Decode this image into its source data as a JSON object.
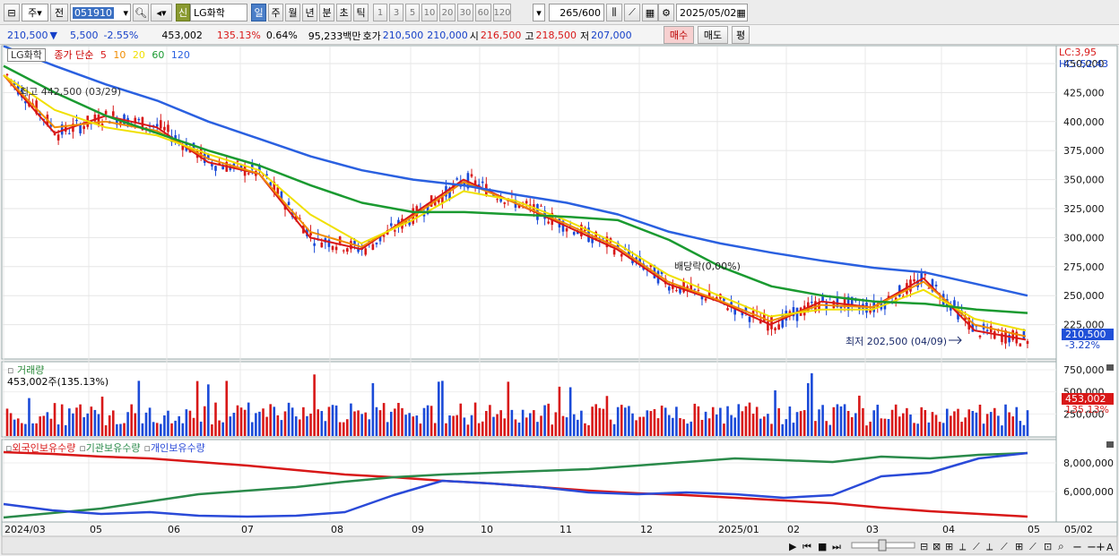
{
  "toolbar": {
    "period_label": "주",
    "prev_label": "전",
    "code": "051910",
    "name": "LG화학",
    "credit_badge": "신",
    "periods": [
      "일",
      "주",
      "월",
      "년",
      "분",
      "초",
      "틱"
    ],
    "counts": [
      "1",
      "3",
      "5",
      "10",
      "20",
      "30",
      "60",
      "120"
    ],
    "view_count": "265",
    "view_total": "/600",
    "date": "2025/05/02"
  },
  "info": {
    "price": "210,500",
    "arrow": "▼",
    "change": "5,500",
    "change_pct": "-2.55%",
    "volume": "453,002",
    "vol_ratio": "135.13%",
    "turnover": "0.64%",
    "amount": "95,233백만",
    "hoga_label": "호가",
    "ask": "210,500",
    "bid": "210,000",
    "open_label": "시",
    "open": "216,500",
    "high_label": "고",
    "high": "218,500",
    "low_label": "저",
    "low": "207,000",
    "buy": "매수",
    "sell": "매도",
    "eval": "평"
  },
  "legend": {
    "stock": "LG화학",
    "ma_label": "종가 단순",
    "ma": [
      "5",
      "10",
      "20",
      "60",
      "120"
    ],
    "ma_colors": [
      "#d81818",
      "#f08c00",
      "#f0e000",
      "#1a9a30",
      "#2a60e0"
    ],
    "lc": "LC:3,95",
    "hc": "HC:-52,43",
    "high_note": "최고 442,500 (03/29)",
    "low_note": "최저 202,500 (04/09)",
    "div_note": "배당락(0,00%)",
    "last_price": "210,500",
    "last_pct": "-3.22%",
    "vol_title": "거래량",
    "vol_value": "453,002주(135.13%)",
    "vol_last": "453,002",
    "vol_last_pct": "135.13%",
    "own_items": [
      "외국인보유수량",
      "기관보유수량",
      "개인보유수량"
    ]
  },
  "chart_data": [
    {
      "type": "line",
      "title": "",
      "x": [
        "2024/03",
        "05",
        "06",
        "07",
        "08",
        "09",
        "10",
        "11",
        "12",
        "2025/01",
        "02",
        "03",
        "04",
        "05",
        "05/02"
      ],
      "y_ticks": [
        "450,000",
        "425,000",
        "400,000",
        "375,000",
        "350,000",
        "325,000",
        "300,000",
        "275,000",
        "250,000",
        "225,000"
      ],
      "ylim": [
        200000,
        460000
      ],
      "series": [
        {
          "name": "5",
          "values": [
            440000,
            390000,
            405000,
            395000,
            365000,
            355000,
            300000,
            290000,
            320000,
            350000,
            330000,
            310000,
            290000,
            260000,
            245000,
            225000,
            245000,
            240000,
            265000,
            220000,
            212000
          ]
        },
        {
          "name": "10",
          "values": [
            440000,
            395000,
            400000,
            392000,
            368000,
            355000,
            305000,
            292000,
            318000,
            348000,
            330000,
            312000,
            292000,
            262000,
            246000,
            228000,
            242000,
            240000,
            262000,
            225000,
            215000
          ]
        },
        {
          "name": "20",
          "values": [
            440000,
            410000,
            395000,
            388000,
            372000,
            358000,
            320000,
            295000,
            315000,
            340000,
            332000,
            315000,
            295000,
            268000,
            250000,
            232000,
            238000,
            238000,
            255000,
            230000,
            220000
          ]
        },
        {
          "name": "60",
          "values": [
            448000,
            425000,
            405000,
            390000,
            375000,
            362000,
            345000,
            330000,
            322000,
            322000,
            320000,
            318000,
            315000,
            298000,
            275000,
            258000,
            250000,
            245000,
            243000,
            238000,
            235000
          ]
        },
        {
          "name": "120",
          "values": [
            465000,
            448000,
            432000,
            418000,
            400000,
            385000,
            370000,
            358000,
            350000,
            345000,
            337000,
            330000,
            320000,
            305000,
            295000,
            287000,
            280000,
            274000,
            270000,
            260000,
            250000
          ]
        }
      ]
    },
    {
      "type": "bar",
      "title": "",
      "y_ticks": [
        "750,000",
        "500,000",
        "250,000"
      ],
      "ylim": [
        0,
        800000
      ],
      "values": []
    },
    {
      "type": "line",
      "title": "",
      "y_ticks": [
        "8,000,000",
        "6,000,000"
      ],
      "series": [
        {
          "name": "외국인보유수량"
        },
        {
          "name": "기관보유수량"
        },
        {
          "name": "개인보유수량"
        }
      ]
    }
  ]
}
